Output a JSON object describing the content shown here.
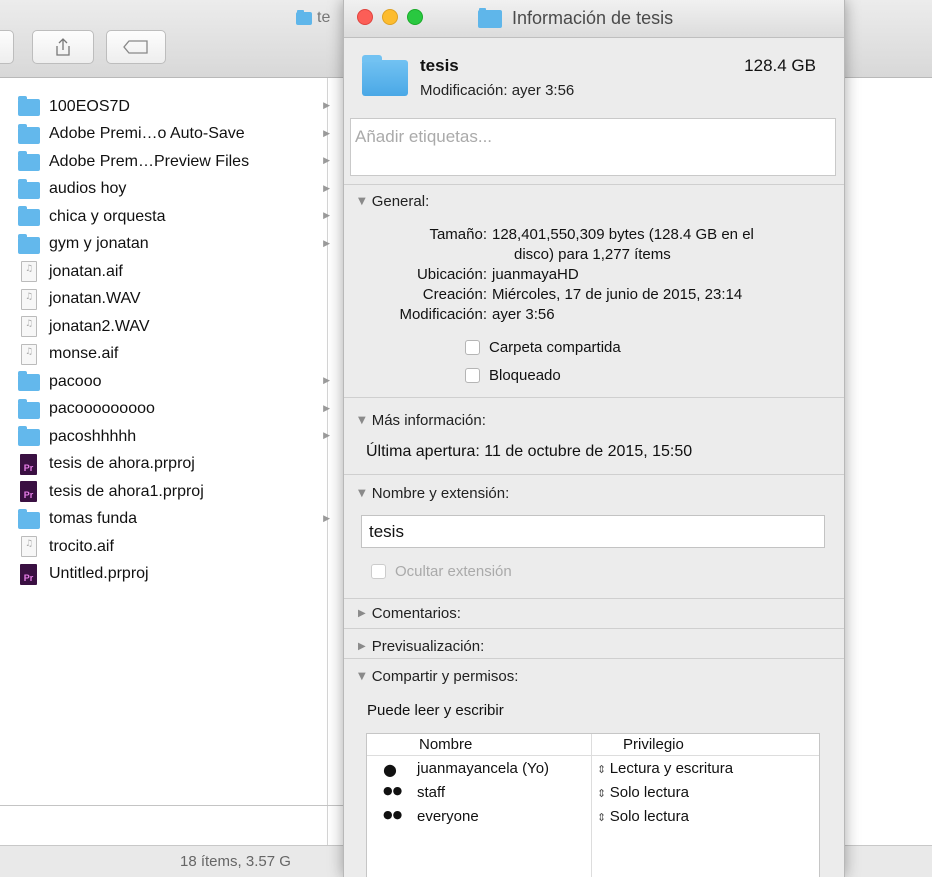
{
  "finder": {
    "title_fragment": "te",
    "status": "18 ítems, 3.57 G",
    "items": [
      {
        "name": "100EOS7D",
        "kind": "folder",
        "arrow": true
      },
      {
        "name": "Adobe Premi…o Auto-Save",
        "kind": "folder",
        "arrow": true
      },
      {
        "name": "Adobe Prem…Preview Files",
        "kind": "folder",
        "arrow": true
      },
      {
        "name": "audios hoy",
        "kind": "folder",
        "arrow": true
      },
      {
        "name": "chica y orquesta",
        "kind": "folder",
        "arrow": true
      },
      {
        "name": "gym y jonatan",
        "kind": "folder",
        "arrow": true
      },
      {
        "name": "jonatan.aif",
        "kind": "audio",
        "arrow": false
      },
      {
        "name": "jonatan.WAV",
        "kind": "audio",
        "arrow": false
      },
      {
        "name": "jonatan2.WAV",
        "kind": "audio",
        "arrow": false
      },
      {
        "name": "monse.aif",
        "kind": "audio",
        "arrow": false
      },
      {
        "name": "pacooo",
        "kind": "folder",
        "arrow": true
      },
      {
        "name": "pacooooooooo",
        "kind": "folder",
        "arrow": true
      },
      {
        "name": "pacoshhhhh",
        "kind": "folder",
        "arrow": true
      },
      {
        "name": "tesis de ahora.prproj",
        "kind": "premiere",
        "arrow": false
      },
      {
        "name": "tesis de ahora1.prproj",
        "kind": "premiere",
        "arrow": false
      },
      {
        "name": "tomas funda",
        "kind": "folder",
        "arrow": true
      },
      {
        "name": "trocito.aif",
        "kind": "audio",
        "arrow": false
      },
      {
        "name": "Untitled.prproj",
        "kind": "premiere",
        "arrow": false
      }
    ]
  },
  "info": {
    "window_title": "Información de tesis",
    "name": "tesis",
    "size": "128.4 GB",
    "mod_label": "Modificación:",
    "mod_value": "ayer 3:56",
    "tags_placeholder": "Añadir etiquetas...",
    "general": {
      "title": "General:",
      "size_label": "Tamaño:",
      "size_value_1": "128,401,550,309 bytes (128.4 GB en el",
      "size_value_2": "disco) para 1,277 ítems",
      "loc_label": "Ubicación:",
      "loc_value": "juanmayaHD",
      "created_label": "Creación:",
      "created_value": "Miércoles, 17 de junio de 2015, 23:14",
      "mod_label": "Modificación:",
      "mod_value": "ayer 3:56",
      "shared_folder": "Carpeta compartida",
      "locked": "Bloqueado"
    },
    "more": {
      "title": "Más información:",
      "last_opened": "Última apertura: 11 de octubre de 2015, 15:50"
    },
    "name_ext": {
      "title": "Nombre y extensión:",
      "value": "tesis",
      "hide_ext": "Ocultar extensión"
    },
    "comments_title": "Comentarios:",
    "preview_title": "Previsualización:",
    "sharing": {
      "title": "Compartir y permisos:",
      "summary": "Puede leer y escribir",
      "col_name": "Nombre",
      "col_priv": "Privilegio",
      "rows": [
        {
          "name": "juanmayancela (Yo)",
          "priv": "Lectura y escritura",
          "icon": "user-icon"
        },
        {
          "name": "staff",
          "priv": "Solo lectura",
          "icon": "group-icon"
        },
        {
          "name": "everyone",
          "priv": "Solo lectura",
          "icon": "everyone-icon"
        }
      ]
    }
  }
}
